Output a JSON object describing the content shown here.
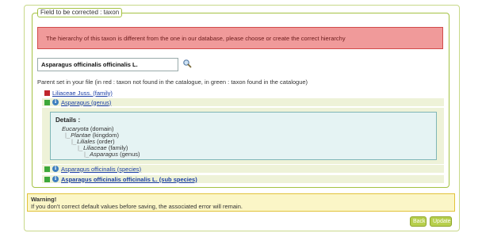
{
  "panel": {
    "legend": "Field to be corrected : taxon"
  },
  "error": {
    "message": "The hierarchy of this taxon is different from the one in our database, please choose or create the correct hierarchy"
  },
  "search": {
    "value": "Asparagus officinalis officinalis L.",
    "icon": "magnifier-icon"
  },
  "parent_text": "Parent set in your file (in red : taxon not found in the catalogue, in green : taxon found in the catalogue)",
  "tree": [
    {
      "label": "Liliaceae Juss. (family)",
      "status": "red",
      "info": false,
      "bold": false
    },
    {
      "label": "Asparagus (genus)",
      "status": "green",
      "info": true,
      "bold": false
    },
    {
      "label": "Asparagus officinalis (species)",
      "status": "green",
      "info": true,
      "bold": false
    },
    {
      "label": "Asparagus officinalis officinalis L. (sub species)",
      "status": "green",
      "info": true,
      "bold": true
    }
  ],
  "details": {
    "title": "Details :",
    "nodes": [
      {
        "name": "Eucaryota",
        "rank": "(domain)"
      },
      {
        "name": "Plantae",
        "rank": "(kingdom)"
      },
      {
        "name": "Liliales",
        "rank": "(order)"
      },
      {
        "name": "Liliaceae",
        "rank": "(family)"
      },
      {
        "name": "Asparagus",
        "rank": "(genus)"
      }
    ]
  },
  "warning": {
    "title": "Warning!",
    "message": "If you don't correct default values before saving, the associated error will remain."
  },
  "buttons": {
    "back": "Back",
    "update": "Update"
  },
  "colors": {
    "found": "#3da83a",
    "not_found": "#c0262d",
    "link": "#1b3fa6",
    "button": "#b7cf4d"
  }
}
